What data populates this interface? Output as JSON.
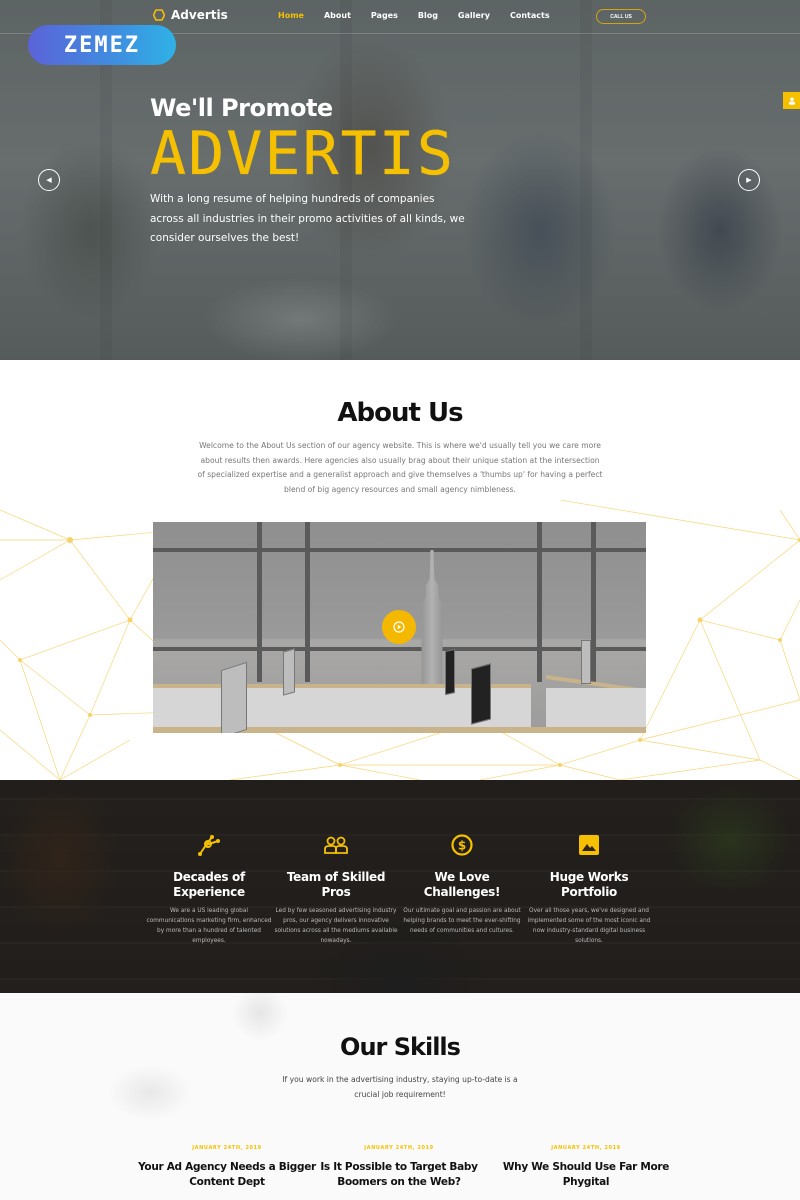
{
  "nav": {
    "brand": "Advertis",
    "items": [
      {
        "label": "Home",
        "active": true
      },
      {
        "label": "About",
        "active": false
      },
      {
        "label": "Pages",
        "active": false
      },
      {
        "label": "Blog",
        "active": false
      },
      {
        "label": "Gallery",
        "active": false
      },
      {
        "label": "Contacts",
        "active": false
      }
    ],
    "cta": "CALL US"
  },
  "badge": "ZEMEZ",
  "hero": {
    "kicker": "We'll Promote",
    "title": "ADVERTIS",
    "text": "With a long resume of helping hundreds of companies across all industries in their promo activities of all kinds, we consider ourselves the best!",
    "prev_icon": "chevron-left-icon",
    "next_icon": "chevron-right-icon",
    "side_tab_icon": "user-icon"
  },
  "about": {
    "title": "About Us",
    "text": "Welcome to the About Us section of our agency website. This is where we'd usually tell you we care more about results then awards. Here agencies also usually brag about their unique station at the intersection of specialized expertise and a generalist approach and give themselves a 'thumbs up' for having a perfect blend of big agency resources and small agency nimbleness.",
    "video_play_icon": "play-icon"
  },
  "features": [
    {
      "icon": "network-icon",
      "title": "Decades of Experience",
      "text": "We are a US leading global communications marketing firm, enhanced by more than a hundred of talented employees."
    },
    {
      "icon": "team-icon",
      "title": "Team of Skilled Pros",
      "text": "Led by few seasoned advertising industry pros, our agency delivers innovative solutions across all the mediums available nowadays."
    },
    {
      "icon": "dollar-icon",
      "title": "We Love Challenges!",
      "text": "Our ultimate goal and passion are about helping brands to meet the ever-shifting needs of communities and cultures."
    },
    {
      "icon": "image-icon",
      "title": "Huge Works Portfolio",
      "text": "Over all those years, we've designed and implemented some of the most iconic and now industry-standard digital business solutions."
    }
  ],
  "skills": {
    "title": "Our Skills",
    "text": "If you work in the advertising industry, staying up-to-date is a crucial job requirement!"
  },
  "posts": [
    {
      "date": "JANUARY 24TH, 2019",
      "title": "Your Ad Agency Needs a Bigger Content Dept"
    },
    {
      "date": "JANUARY 24TH, 2019",
      "title": "Is It Possible to Target Baby Boomers on the Web?"
    },
    {
      "date": "JANUARY 24TH, 2019",
      "title": "Why We Should Use Far More Phygital"
    }
  ],
  "colors": {
    "accent": "#f5c000",
    "dark": "#111111",
    "badge_start": "#5b63d8",
    "badge_end": "#2fb2e6"
  }
}
